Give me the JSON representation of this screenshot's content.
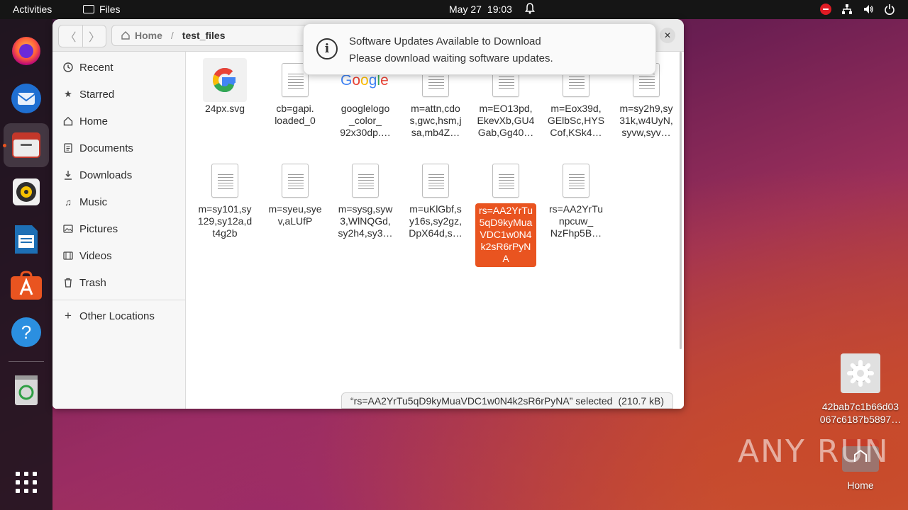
{
  "topbar": {
    "activities": "Activities",
    "app_name": "Files",
    "date": "May 27",
    "time": "19:03",
    "icons": [
      "bell-icon",
      "stop-icon",
      "network-icon",
      "volume-icon",
      "power-icon"
    ]
  },
  "dock": {
    "items": [
      "firefox-icon",
      "thunderbird-icon",
      "files-icon",
      "rhythmbox-icon",
      "writer-icon",
      "app-center-icon",
      "help-icon",
      "trash-icon"
    ],
    "apps_grid": "show-apps-icon"
  },
  "window": {
    "path": {
      "home": "Home",
      "current": "test_files"
    },
    "sidebar": [
      {
        "label": "Recent",
        "icon": "clock-icon"
      },
      {
        "label": "Starred",
        "icon": "star-icon"
      },
      {
        "label": "Home",
        "icon": "home-icon"
      },
      {
        "label": "Documents",
        "icon": "document-icon"
      },
      {
        "label": "Downloads",
        "icon": "download-icon"
      },
      {
        "label": "Music",
        "icon": "music-icon"
      },
      {
        "label": "Pictures",
        "icon": "picture-icon"
      },
      {
        "label": "Videos",
        "icon": "video-icon"
      },
      {
        "label": "Trash",
        "icon": "trash-icon"
      },
      {
        "label": "Other Locations",
        "icon": "plus-icon"
      }
    ],
    "files": [
      {
        "name": "24px.svg",
        "kind": "google-g"
      },
      {
        "name": "cb=gapi.\nloaded_0",
        "kind": "doc"
      },
      {
        "name": "googlelogo\n_color_\n92x30dp.…",
        "kind": "google-logo"
      },
      {
        "name": "m=attn,cdo\ns,gwc,hsm,j\nsa,mb4Z…",
        "kind": "doc"
      },
      {
        "name": "m=EO13pd,\nEkevXb,GU4\nGab,Gg40…",
        "kind": "doc"
      },
      {
        "name": "m=Eox39d,\nGElbSc,HYS\nCof,KSk4…",
        "kind": "doc"
      },
      {
        "name": "m=sy2h9,sy\n31k,w4UyN,\nsyvw,syv…",
        "kind": "doc"
      },
      {
        "name": "m=sy101,sy\n129,sy12a,d\nt4g2b",
        "kind": "doc"
      },
      {
        "name": "m=syeu,sye\nv,aLUfP",
        "kind": "doc"
      },
      {
        "name": "m=sysg,syw\n3,WlNQGd,\nsy2h4,sy3…",
        "kind": "doc"
      },
      {
        "name": "m=uKlGbf,s\ny16s,sy2gz,\nDpX64d,s…",
        "kind": "doc"
      },
      {
        "name": "rs=AA2YrTu\n5qD9kyMua\nVDC1w0N4\nk2sR6rPyN\nA",
        "kind": "doc",
        "selected": true
      },
      {
        "name": "rs=AA2YrTu\nnpcuw_\nNzFhp5B…",
        "kind": "doc"
      }
    ],
    "status": {
      "selected": "“rs=AA2YrTu5qD9kyMuaVDC1w0N4k2sR6rPyNA” selected",
      "size": "(210.7 kB)"
    }
  },
  "notification": {
    "title": "Software Updates Available to Download",
    "body": "Please download waiting software updates."
  },
  "desktop": {
    "file_icon_label": "42bab7c1b66d03\n067c6187b5897…",
    "home_label": "Home",
    "watermark": "ANY RUN"
  },
  "colors": {
    "accent": "#e95420",
    "topbar": "#151515"
  }
}
